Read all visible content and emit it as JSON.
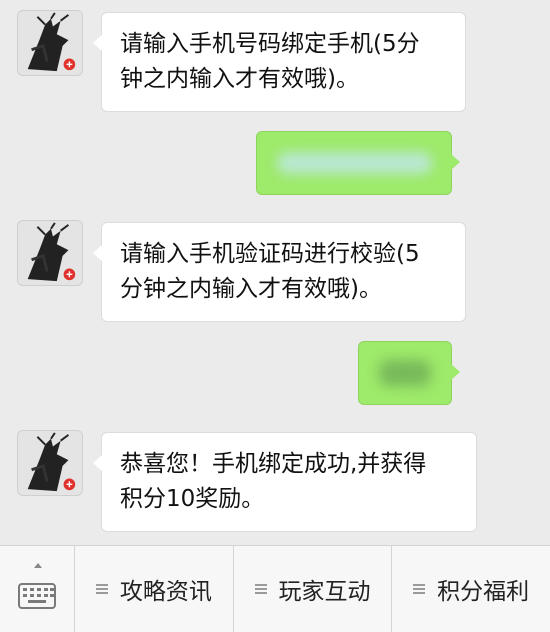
{
  "messages": [
    {
      "from": "bot",
      "lines": [
        "请输入手机号码绑定手机(5分",
        "钟之内输入才有效哦)。"
      ]
    },
    {
      "from": "user",
      "content": "redacted-phone-number"
    },
    {
      "from": "bot",
      "lines": [
        "请输入手机验证码进行校验(5",
        "分钟之内输入才有效哦)。"
      ]
    },
    {
      "from": "user",
      "content": "redacted-code"
    },
    {
      "from": "bot",
      "lines": [
        "恭喜您！手机绑定成功,并获得",
        "积分10奖励。"
      ]
    }
  ],
  "menu": {
    "keyboard_icon": "keyboard-icon",
    "items": [
      {
        "label": "攻略资讯",
        "icon": "menu-list-icon"
      },
      {
        "label": "玩家互动",
        "icon": "menu-list-icon"
      },
      {
        "label": "积分福利",
        "icon": "menu-list-icon"
      }
    ]
  },
  "colors": {
    "chat_background": "#ebebeb",
    "outgoing_bubble": "#9eea6a",
    "incoming_bubble": "#ffffff",
    "avatar_logo": "#e0322c"
  }
}
